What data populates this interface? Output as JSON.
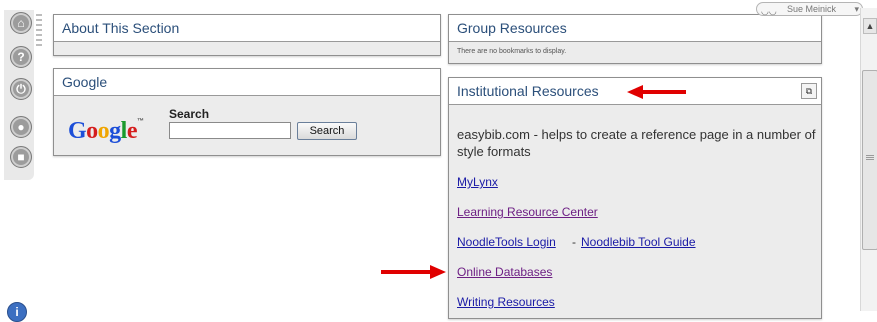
{
  "user_menu": {
    "name": "Sue Meinick",
    "caret": "▾",
    "avatar": "◡◡"
  },
  "rail": {
    "icons": [
      {
        "name": "home-icon",
        "glyph": "⌂"
      },
      {
        "name": "help-icon",
        "glyph": "?"
      },
      {
        "name": "power-icon",
        "glyph": "⏻"
      },
      {
        "name": "chat-icon",
        "glyph": "●"
      },
      {
        "name": "comment-icon",
        "glyph": "■"
      }
    ],
    "info_glyph": "i"
  },
  "about": {
    "title": "About This Section"
  },
  "google": {
    "title": "Google",
    "logo": [
      "G",
      "o",
      "o",
      "g",
      "l",
      "e"
    ],
    "logo_tm": "™",
    "search_label": "Search",
    "search_value": "",
    "search_button": "Search"
  },
  "group_resources": {
    "title": "Group Resources",
    "empty_text": "There are no bookmarks to display."
  },
  "institutional": {
    "title": "Institutional Resources",
    "restore_glyph": "⧉",
    "intro": "easybib.com - helps to create a reference page in a number of style formats",
    "links": {
      "mylynx": "MyLynx",
      "lrc": "Learning Resource Center",
      "noodletools": "NoodleTools Login",
      "separator": "-",
      "noodlebib": "Noodlebib Tool Guide",
      "databases": "Online Databases",
      "writing": "Writing Resources"
    }
  },
  "scrollbar": {
    "up": "▲"
  },
  "colors": {
    "link": "#1a1aa6",
    "visited": "#6d1f84",
    "arrow": "#e00000",
    "panel_title": "#2b4f7a",
    "panel_body": "#ececec"
  }
}
